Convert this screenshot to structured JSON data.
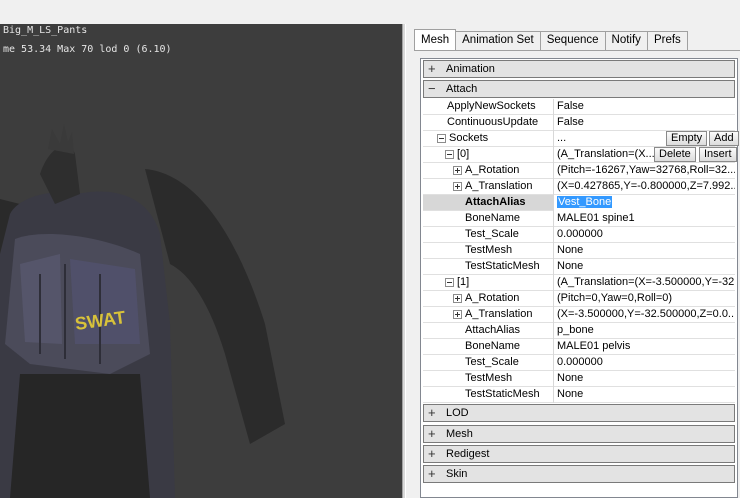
{
  "viewport": {
    "line1": "Big_M_LS_Pants",
    "line2": "me 53.34 Max 70  lod 0 (6.10)",
    "vest_text": "SWAT"
  },
  "tabs": [
    {
      "label": "Mesh",
      "active": true
    },
    {
      "label": "Animation Set",
      "active": false
    },
    {
      "label": "Sequence",
      "active": false
    },
    {
      "label": "Notify",
      "active": false
    },
    {
      "label": "Prefs",
      "active": false
    }
  ],
  "properties": {
    "categories": {
      "animation": "Animation",
      "attach": "Attach",
      "lod": "LOD",
      "mesh": "Mesh",
      "redigest": "Redigest",
      "skin": "Skin"
    },
    "apply_new_sockets": {
      "name": "ApplyNewSockets",
      "value": "False"
    },
    "continuous_update": {
      "name": "ContinuousUpdate",
      "value": "False"
    },
    "sockets": {
      "name": "Sockets",
      "value": "...",
      "empty_label": "Empty",
      "add_label": "Add"
    },
    "socket0": {
      "index": "[0]",
      "value": "(A_Translation=(X...",
      "delete_label": "Delete",
      "insert_label": "Insert",
      "rotation": {
        "name": "A_Rotation",
        "value": "(Pitch=-16267,Yaw=32768,Roll=32..."
      },
      "translation": {
        "name": "A_Translation",
        "value": "(X=0.427865,Y=-0.800000,Z=7.992..."
      },
      "attach_alias": {
        "name": "AttachAlias",
        "value": "Vest_Bone"
      },
      "bone_name": {
        "name": "BoneName",
        "value": "MALE01 spine1"
      },
      "test_scale": {
        "name": "Test_Scale",
        "value": "0.000000"
      },
      "test_mesh": {
        "name": "TestMesh",
        "value": "None"
      },
      "test_static_mesh": {
        "name": "TestStaticMesh",
        "value": "None"
      }
    },
    "socket1": {
      "index": "[1]",
      "value": "(A_Translation=(X=-3.500000,Y=-32...",
      "rotation": {
        "name": "A_Rotation",
        "value": "(Pitch=0,Yaw=0,Roll=0)"
      },
      "translation": {
        "name": "A_Translation",
        "value": "(X=-3.500000,Y=-32.500000,Z=0.0..."
      },
      "attach_alias": {
        "name": "AttachAlias",
        "value": "p_bone"
      },
      "bone_name": {
        "name": "BoneName",
        "value": "MALE01 pelvis"
      },
      "test_scale": {
        "name": "Test_Scale",
        "value": "0.000000"
      },
      "test_mesh": {
        "name": "TestMesh",
        "value": "None"
      },
      "test_static_mesh": {
        "name": "TestStaticMesh",
        "value": "None"
      }
    }
  },
  "colors": {
    "viewport_bg": "#3d3d3d",
    "selection": "#3399ff",
    "category_bg": "#e3e3e3"
  }
}
